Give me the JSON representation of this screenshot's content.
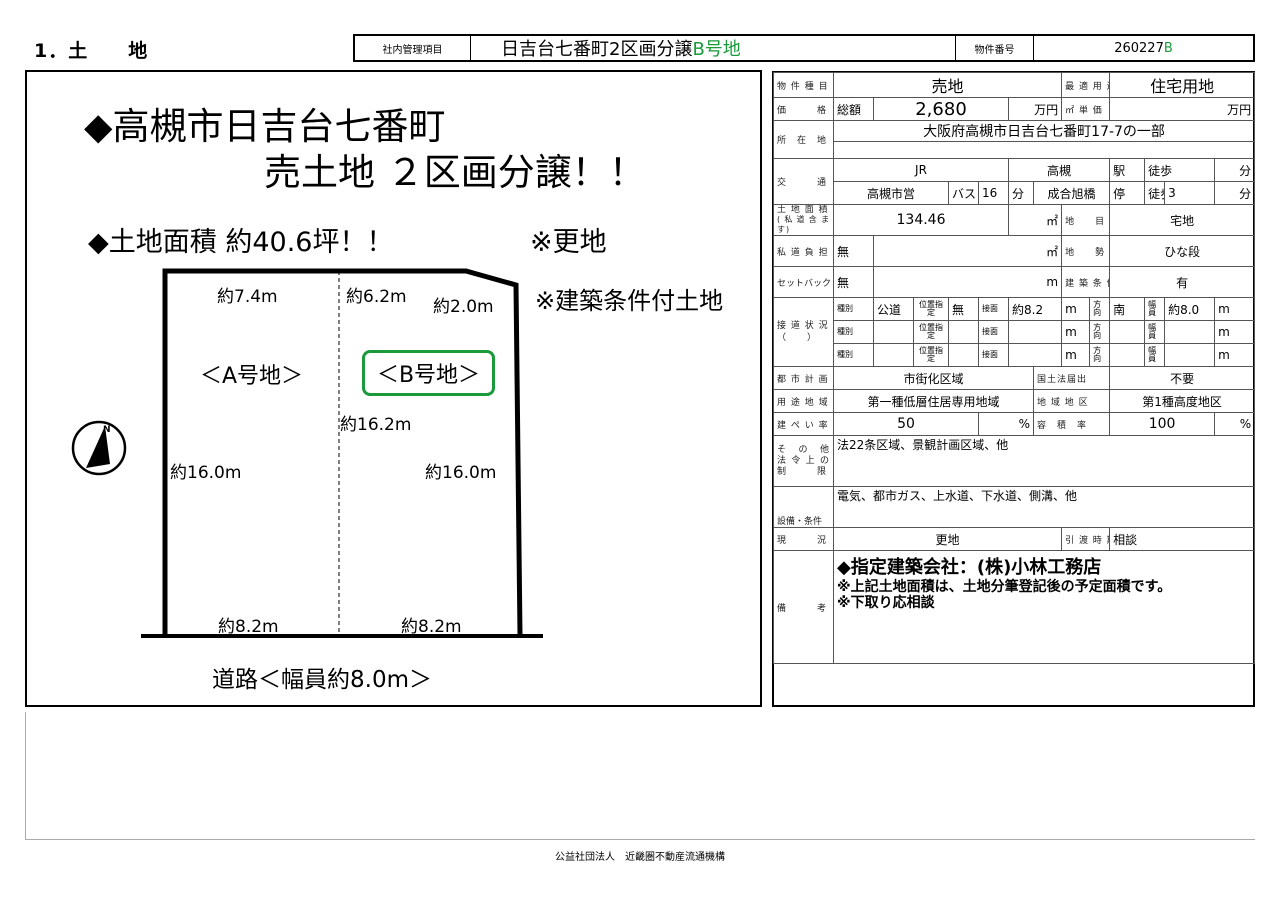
{
  "section_title": "1．土　　地",
  "header": {
    "mgmt_label": "社内管理項目",
    "property_name": "日吉台七番町2区画分譲 ",
    "property_suffix": "B号地",
    "number_label": "物件番号",
    "number_value": "260227",
    "number_suffix": "B"
  },
  "flyer": {
    "headline1": "◆高槻市日吉台七番町",
    "headline2": "売土地 ２区画分譲！！",
    "area_text": "◆土地面積 約40.6坪！！",
    "sarachi": "※更地",
    "condition": "※建築条件付土地",
    "road": "道路＜幅員約8.0m＞",
    "lot_a": "＜A号地＞",
    "lot_b": "＜B号地＞",
    "dims": {
      "a_top": "約7.4m",
      "b_top": "約6.2m",
      "b_top2": "約2.0m",
      "mid": "約16.2m",
      "a_side": "約16.0m",
      "b_side": "約16.0m",
      "a_bottom": "約8.2m",
      "b_bottom": "約8.2m"
    }
  },
  "spec": {
    "type_label": "物 件 種 目",
    "type_value": "売地",
    "use_label": "最 適 用 途",
    "use_value": "住宅用地",
    "price_label": "価　　　格",
    "price_prefix": "総額",
    "price_value": "2,680",
    "price_unit": "万円",
    "unit_price_label": "㎡ 単 価",
    "unit_price_unit": "万円",
    "address_label": "所　在　地",
    "address_value": "大阪府高槻市日吉台七番町17-7の一部",
    "access_label": "交　　　通",
    "access_row1_line": "JR",
    "access_row1_station": "高槻",
    "access_row1_eki": "駅",
    "access_row1_walk": "徒歩",
    "access_row1_unit": "分",
    "access_row2_line": "高槻市営",
    "access_row2_bus": "バス",
    "access_row2_busmin": "16",
    "access_row2_fun": "分",
    "access_row2_stop": "成合旭橋",
    "access_row2_tei": "停",
    "access_row2_walk": "徒歩",
    "access_row2_min": "3",
    "access_row2_unit": "分",
    "land_area_label": "土 地 面 積",
    "land_area_sub": "(私道含ます)",
    "land_area_value": "134.46",
    "sqm": "㎡",
    "chimoku_label": "地　　目",
    "chimoku_value": "宅地",
    "private_road_label": "私 道 負 担",
    "private_road_value": "無",
    "chisei_label": "地　　勢",
    "chisei_value": "ひな段",
    "setback_label": "セットバック",
    "setback_value": "無",
    "m": "m",
    "build_cond_label": "建 築 条 件",
    "build_cond_value": "有",
    "road_label": "接 道 状 況",
    "road_label2": "（　　）",
    "road_kind": "種別",
    "road_kind_value": "公道",
    "road_pos": "位置指定",
    "road_pos_value": "無",
    "road_set": "接面",
    "road_set_value": "約8.2",
    "road_dir": "方向",
    "road_dir_value": "南",
    "road_width": "幅員",
    "road_width_value": "約8.0",
    "city_plan_label": "都 市 計 画",
    "city_plan_value": "市街化区域",
    "kokudo_label": "国土法届出",
    "kokudo_value": "不要",
    "zone_label": "用 途 地 域",
    "zone_value": "第一種低層住居専用地域",
    "district_label": "地 域 地 区",
    "district_value": "第1種高度地区",
    "bcr_label": "建 ぺ い 率",
    "bcr_value": "50",
    "pct": "%",
    "far_label": "容　積　率",
    "far_value": "100",
    "other_label": "そ　の　他 法 令 上 の 制　　　限",
    "other_value": "法22条区域、景観計画区域、他",
    "facilities_label": "設備・条件",
    "facilities_value": "電気、都市ガス、上水道、下水道、側溝、他",
    "status_label": "現　　　況",
    "status_value": "更地",
    "handover_label": "引 渡 時 期",
    "handover_value": "相談",
    "remarks_label": "備　　　考",
    "remarks1": "◆指定建築会社：(株)小林工務店",
    "remarks2": "※上記土地面積は、土地分筆登記後の予定面積です。",
    "remarks3": "※下取り応相談"
  },
  "footer": "公益社団法人　近畿圏不動産流通機構",
  "colors": {
    "accent_green": "#1a9a3a"
  }
}
